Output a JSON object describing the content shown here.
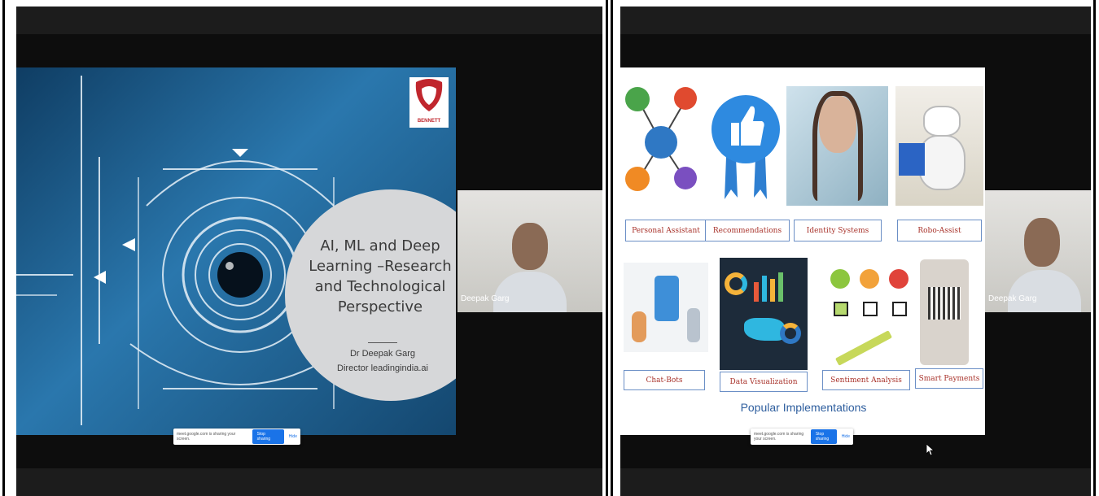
{
  "left_slide": {
    "title_lines": [
      "AI, ML and Deep",
      "Learning –Research",
      "and Technological",
      "Perspective"
    ],
    "author": "Dr Deepak Garg",
    "role": "Director leadingindia.ai",
    "logo_caption": "BENNETT"
  },
  "right_slide": {
    "labels": {
      "personal_assistant": "Personal Assistant",
      "recommendations": "Recommendations",
      "identity_systems": "Identity Systems",
      "robo_assist": "Robo-Assist",
      "chat_bots": "Chat-Bots",
      "data_visualization": "Data Visualization",
      "sentiment_analysis": "Sentiment Analysis",
      "smart_payments": "Smart Payments"
    },
    "footer": "Popular Implementations"
  },
  "participant": {
    "name": "Deepak Garg"
  },
  "share_bar": {
    "message": "meet.google.com is sharing your screen.",
    "stop_label": "Stop sharing",
    "hide_label": "Hide"
  },
  "icons": [
    "home-icon",
    "car-icon",
    "microphone-icon",
    "monitor-icon",
    "phone-icon",
    "thumbs-up-icon",
    "smiley-icon",
    "mouse-cursor-icon"
  ],
  "colors": {
    "accent_blue": "#1a73e8",
    "slide_blue": "#1e5e8e",
    "label_red": "#a8322a",
    "label_border": "#6b8fc6"
  }
}
